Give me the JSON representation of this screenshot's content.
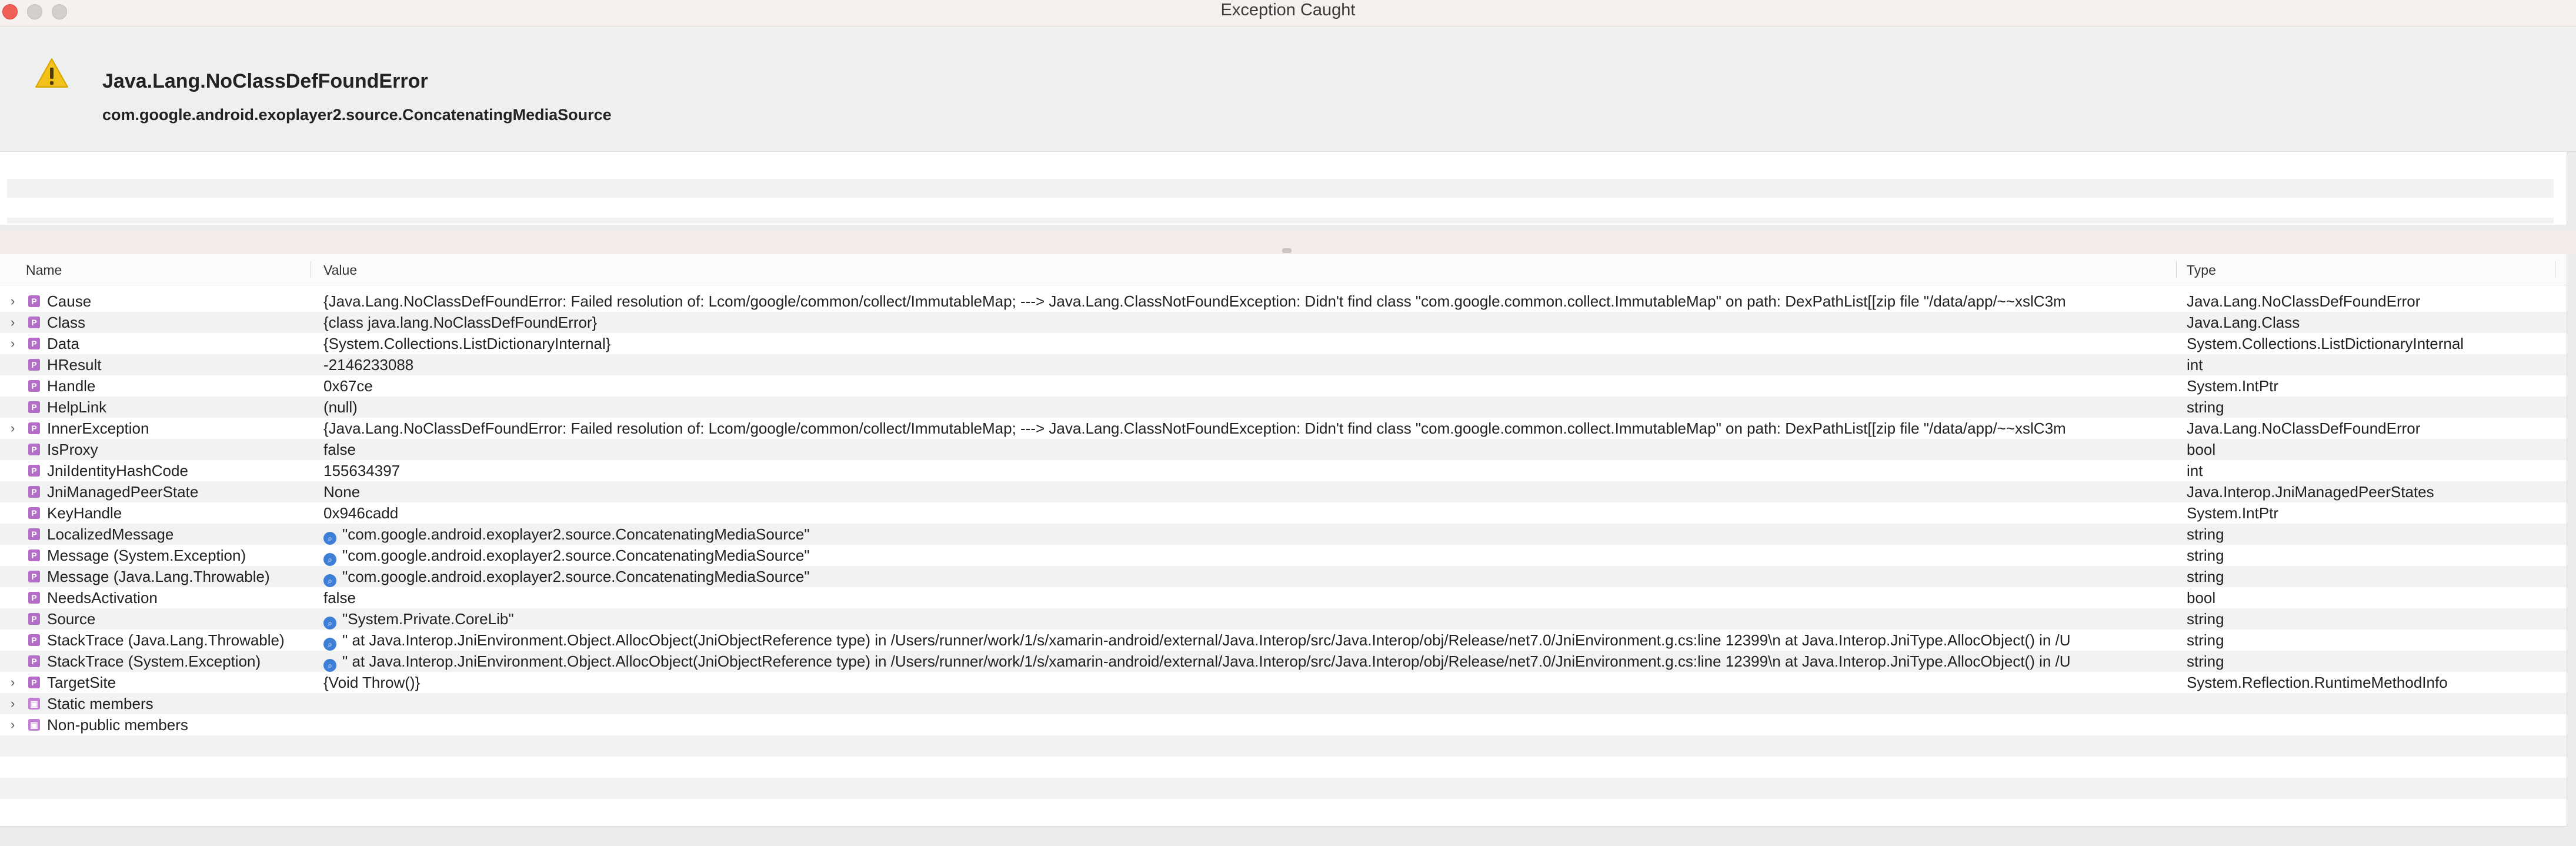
{
  "window": {
    "title": "Exception Caught"
  },
  "exception": {
    "title": "Java.Lang.NoClassDefFoundError",
    "message": "com.google.android.exoplayer2.source.ConcatenatingMediaSource"
  },
  "columns": {
    "name": "Name",
    "value": "Value",
    "type": "Type"
  },
  "icons": {
    "warning": "warning-icon",
    "property": "property-icon",
    "folder": "folder-icon",
    "string_visualizer": "magnifier-icon",
    "expander": "chevron-right-icon"
  },
  "colors": {
    "close": "#ef5f56",
    "property_icon": "#b46ec7",
    "string_icon": "#3d7fd6",
    "warning": "#f2c21b"
  },
  "rows": [
    {
      "name": "Cause",
      "expandable": true,
      "string": false,
      "value": "{Java.Lang.NoClassDefFoundError: Failed resolution of: Lcom/google/common/collect/ImmutableMap;  ---> Java.Lang.ClassNotFoundException: Didn't find class \"com.google.common.collect.ImmutableMap\" on path: DexPathList[[zip file \"/data/app/~~xslC3m",
      "type": "Java.Lang.NoClassDefFoundError"
    },
    {
      "name": "Class",
      "expandable": true,
      "string": false,
      "value": "{class java.lang.NoClassDefFoundError}",
      "type": "Java.Lang.Class"
    },
    {
      "name": "Data",
      "expandable": true,
      "string": false,
      "value": "{System.Collections.ListDictionaryInternal}",
      "type": "System.Collections.ListDictionaryInternal"
    },
    {
      "name": "HResult",
      "expandable": false,
      "string": false,
      "value": "-2146233088",
      "type": "int"
    },
    {
      "name": "Handle",
      "expandable": false,
      "string": false,
      "value": "0x67ce",
      "type": "System.IntPtr"
    },
    {
      "name": "HelpLink",
      "expandable": false,
      "string": false,
      "value": "(null)",
      "type": "string"
    },
    {
      "name": "InnerException",
      "expandable": true,
      "string": false,
      "value": "{Java.Lang.NoClassDefFoundError: Failed resolution of: Lcom/google/common/collect/ImmutableMap;  ---> Java.Lang.ClassNotFoundException: Didn't find class \"com.google.common.collect.ImmutableMap\" on path: DexPathList[[zip file \"/data/app/~~xslC3m",
      "type": "Java.Lang.NoClassDefFoundError"
    },
    {
      "name": "IsProxy",
      "expandable": false,
      "string": false,
      "value": "false",
      "type": "bool"
    },
    {
      "name": "JniIdentityHashCode",
      "expandable": false,
      "string": false,
      "value": "155634397",
      "type": "int"
    },
    {
      "name": "JniManagedPeerState",
      "expandable": false,
      "string": false,
      "value": "None",
      "type": "Java.Interop.JniManagedPeerStates"
    },
    {
      "name": "KeyHandle",
      "expandable": false,
      "string": false,
      "value": "0x946cadd",
      "type": "System.IntPtr"
    },
    {
      "name": "LocalizedMessage",
      "expandable": false,
      "string": true,
      "value": "\"com.google.android.exoplayer2.source.ConcatenatingMediaSource\"",
      "type": "string"
    },
    {
      "name": "Message (System.Exception)",
      "expandable": false,
      "string": true,
      "value": "\"com.google.android.exoplayer2.source.ConcatenatingMediaSource\"",
      "type": "string"
    },
    {
      "name": "Message (Java.Lang.Throwable)",
      "expandable": false,
      "string": true,
      "value": "\"com.google.android.exoplayer2.source.ConcatenatingMediaSource\"",
      "type": "string"
    },
    {
      "name": "NeedsActivation",
      "expandable": false,
      "string": false,
      "value": "false",
      "type": "bool"
    },
    {
      "name": "Source",
      "expandable": false,
      "string": true,
      "value": "\"System.Private.CoreLib\"",
      "type": "string"
    },
    {
      "name": "StackTrace (Java.Lang.Throwable)",
      "expandable": false,
      "string": true,
      "value": "\"   at Java.Interop.JniEnvironment.Object.AllocObject(JniObjectReference type) in /Users/runner/work/1/s/xamarin-android/external/Java.Interop/src/Java.Interop/obj/Release/net7.0/JniEnvironment.g.cs:line 12399\\n   at Java.Interop.JniType.AllocObject() in /U",
      "type": "string"
    },
    {
      "name": "StackTrace (System.Exception)",
      "expandable": false,
      "string": true,
      "value": "\"   at Java.Interop.JniEnvironment.Object.AllocObject(JniObjectReference type) in /Users/runner/work/1/s/xamarin-android/external/Java.Interop/src/Java.Interop/obj/Release/net7.0/JniEnvironment.g.cs:line 12399\\n   at Java.Interop.JniType.AllocObject() in /U",
      "type": "string"
    },
    {
      "name": "TargetSite",
      "expandable": true,
      "string": false,
      "value": "{Void Throw()}",
      "type": "System.Reflection.RuntimeMethodInfo"
    },
    {
      "name": "Static members",
      "expandable": true,
      "string": false,
      "folder": true,
      "value": "",
      "type": ""
    },
    {
      "name": "Non-public members",
      "expandable": true,
      "string": false,
      "folder": true,
      "value": "",
      "type": ""
    }
  ]
}
